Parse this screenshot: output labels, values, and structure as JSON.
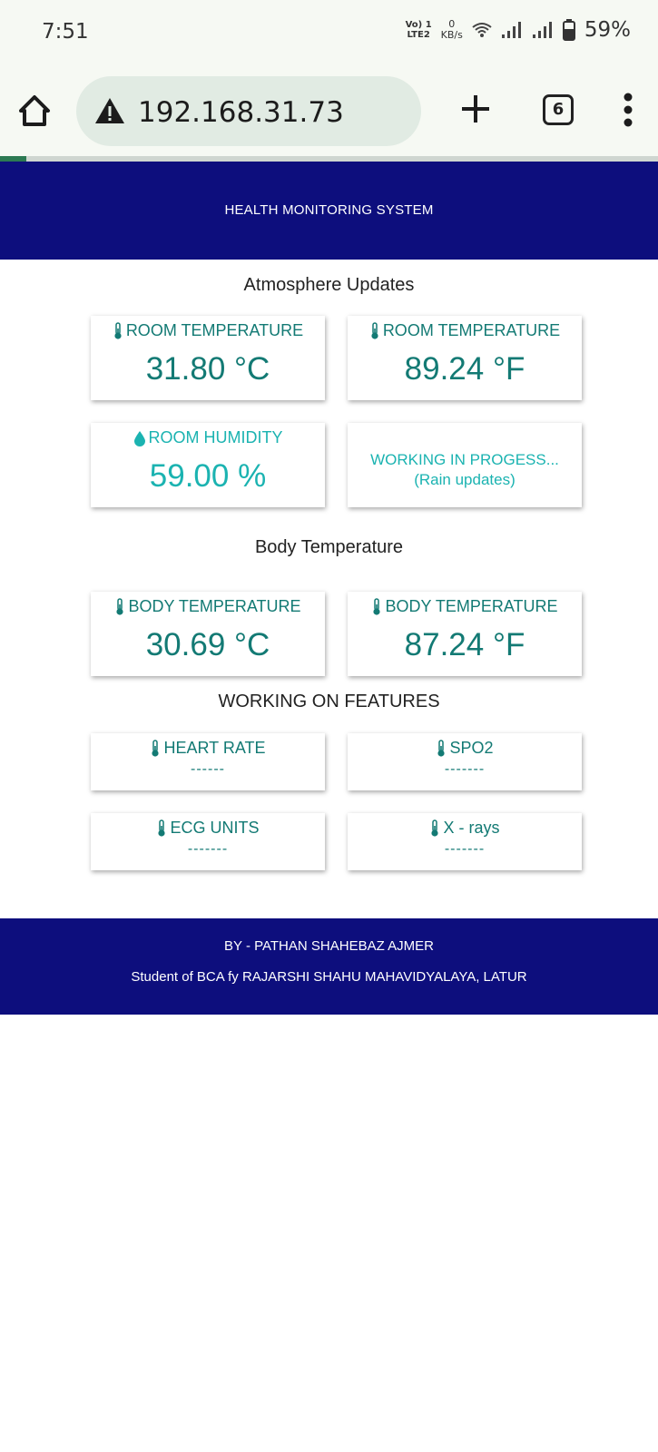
{
  "status_bar": {
    "time": "7:51",
    "volte_line1": "Vo) 1",
    "volte_line2": "LTE2",
    "speed_value": "0",
    "speed_unit": "KB/s",
    "battery_percent": "59%"
  },
  "browser": {
    "url": "192.168.31.73",
    "tab_count": "6",
    "load_progress_percent": 4
  },
  "header": {
    "title": "HEALTH MONITORING SYSTEM",
    "color": "#0d0e7d"
  },
  "sections": {
    "atmosphere": "Atmosphere Updates",
    "body": "Body Temperature",
    "features": "WORKING ON FEATURES"
  },
  "cards": {
    "room_temp_c": {
      "label": "ROOM TEMPERATURE",
      "value": "31.80 °C"
    },
    "room_temp_f": {
      "label": "ROOM TEMPERATURE",
      "value": "89.24 °F"
    },
    "room_humidity": {
      "label": "ROOM HUMIDITY",
      "value": "59.00 %"
    },
    "rain": {
      "line1": "WORKING IN PROGESS...",
      "line2": "(Rain updates)"
    },
    "body_temp_c": {
      "label": "BODY TEMPERATURE",
      "value": "30.69 °C"
    },
    "body_temp_f": {
      "label": "BODY TEMPERATURE",
      "value": "87.24 °F"
    },
    "heart_rate": {
      "label": "HEART RATE",
      "value": "------"
    },
    "spo2": {
      "label": "SPO2",
      "value": "-------"
    },
    "ecg": {
      "label": "ECG UNITS",
      "value": "-------"
    },
    "xrays": {
      "label": "X - rays",
      "value": "-------"
    }
  },
  "footer": {
    "author": "BY - PATHAN SHAHEBAZ AJMER",
    "institution": "Student of BCA fy RAJARSHI SHAHU MAHAVIDYALAYA, LATUR"
  },
  "colors": {
    "teal": "#137a74",
    "light_teal": "#1bb3b1",
    "nav_blue": "#0d0e7d"
  },
  "icons": [
    "home-icon",
    "warning-icon",
    "plus-icon",
    "tabs-icon",
    "more-vert-icon",
    "thermometer-icon",
    "water-drop-icon",
    "wifi-icon",
    "signal-icon",
    "battery-icon"
  ]
}
